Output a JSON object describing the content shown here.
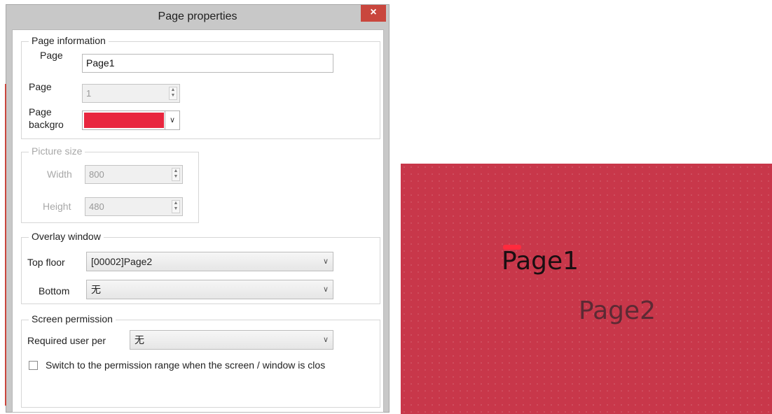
{
  "dialog": {
    "title": "Page properties",
    "close_label": "×",
    "page_information": {
      "legend": "Page information",
      "page_name_label": "Page",
      "page_name_value": "Page1",
      "page_number_label": "Page",
      "page_number_value": "1",
      "background_label_line1": "Page",
      "background_label_line2": "backgro",
      "background_color": "#e8273f"
    },
    "picture_size": {
      "legend": "Picture size",
      "width_label": "Width",
      "width_value": "800",
      "height_label": "Height",
      "height_value": "480"
    },
    "overlay_window": {
      "legend": "Overlay window",
      "top_floor_label": "Top floor",
      "top_floor_value": "[00002]Page2",
      "bottom_label": "Bottom",
      "bottom_value": "无"
    },
    "screen_permission": {
      "legend": "Screen permission",
      "required_label": "Required user per",
      "required_value": "无",
      "switch_checkbox_label": "Switch to the permission range when the screen / window is clos",
      "switch_checked": false
    }
  },
  "preview": {
    "background_color": "#c8374a",
    "page1_text": "Page1",
    "page2_text": "Page2"
  }
}
